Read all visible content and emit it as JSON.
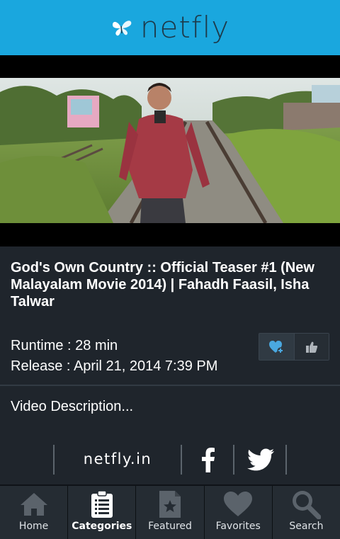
{
  "header": {
    "brand": "netfly",
    "logo_icon": "butterfly-icon",
    "background_color": "#1aa7de"
  },
  "video": {
    "thumbnail": "video-thumbnail-man-on-railway-track"
  },
  "movie": {
    "title": "God's Own Country :: Official Teaser #1 (New Malayalam Movie 2014)  | Fahadh Faasil, Isha Talwar",
    "runtime": "Runtime : 28 min",
    "release": "Release : April 21, 2014 7:39 PM"
  },
  "actions": {
    "favorite_icon": "heart-plus-icon",
    "like_icon": "thumbs-up-icon",
    "accent_color": "#4aa8e0"
  },
  "description": {
    "label": "Video Description..."
  },
  "social": {
    "site": "netfly.in",
    "facebook_icon": "facebook-icon",
    "twitter_icon": "twitter-icon"
  },
  "tabs": [
    {
      "label": "Home",
      "icon": "home-icon",
      "active": false
    },
    {
      "label": "Categories",
      "icon": "clipboard-list-icon",
      "active": true
    },
    {
      "label": "Featured",
      "icon": "star-document-icon",
      "active": false
    },
    {
      "label": "Favorites",
      "icon": "heart-icon",
      "active": false
    },
    {
      "label": "Search",
      "icon": "search-icon",
      "active": false
    }
  ]
}
